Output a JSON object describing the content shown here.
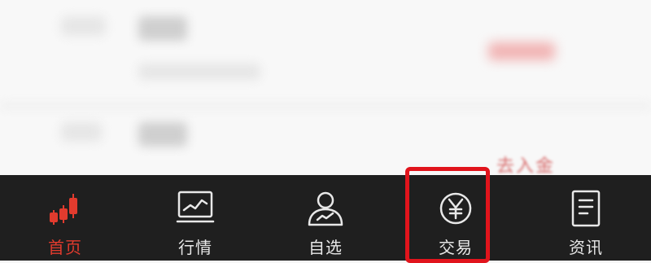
{
  "background_peek_text": "去入金",
  "tabbar": {
    "items": [
      {
        "label": "首页",
        "icon": "candlestick-chart-icon",
        "active": true
      },
      {
        "label": "行情",
        "icon": "line-chart-monitor-icon",
        "active": false
      },
      {
        "label": "自选",
        "icon": "user-chart-icon",
        "active": false
      },
      {
        "label": "交易",
        "icon": "yen-coin-icon",
        "active": false
      },
      {
        "label": "资讯",
        "icon": "document-icon",
        "active": false
      }
    ]
  },
  "colors": {
    "active": "#e23b2e",
    "inactive": "#e8e8e8",
    "tabbar_bg": "#1f1f1f",
    "highlight": "#e1141c"
  }
}
